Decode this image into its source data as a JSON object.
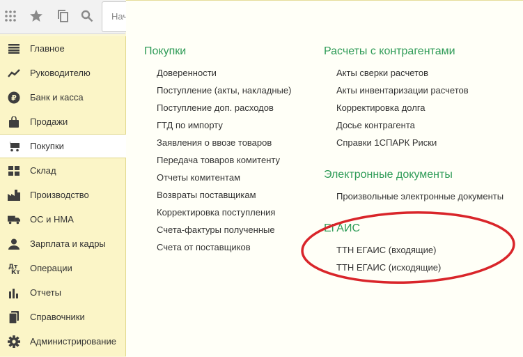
{
  "toolbar": {
    "icons": [
      "apps-grid-icon",
      "star-icon",
      "history-icon",
      "search-icon"
    ],
    "search_text": "Нач"
  },
  "sidebar": {
    "items": [
      {
        "label": "Главное",
        "icon": "menu-lines-icon"
      },
      {
        "label": "Руководителю",
        "icon": "trend-icon"
      },
      {
        "label": "Банк и касса",
        "icon": "ruble-coin-icon"
      },
      {
        "label": "Продажи",
        "icon": "shopping-bag-icon"
      },
      {
        "label": "Покупки",
        "icon": "cart-icon",
        "active": true
      },
      {
        "label": "Склад",
        "icon": "warehouse-grid-icon"
      },
      {
        "label": "Производство",
        "icon": "factory-icon"
      },
      {
        "label": "ОС и НМА",
        "icon": "truck-icon"
      },
      {
        "label": "Зарплата и кадры",
        "icon": "person-icon"
      },
      {
        "label": "Операции",
        "icon": "debit-credit-icon"
      },
      {
        "label": "Отчеты",
        "icon": "bar-chart-icon"
      },
      {
        "label": "Справочники",
        "icon": "books-icon"
      },
      {
        "label": "Администрирование",
        "icon": "gear-icon"
      }
    ]
  },
  "sections": {
    "purchases": {
      "title": "Покупки",
      "links": [
        "Доверенности",
        "Поступление (акты, накладные)",
        "Поступление доп. расходов",
        "ГТД по импорту",
        "Заявления о ввозе товаров",
        "Передача товаров комитенту",
        "Отчеты комитентам",
        "Возвраты поставщикам",
        "Корректировка поступления",
        "Счета-фактуры полученные",
        "Счета от поставщиков"
      ]
    },
    "settlements": {
      "title": "Расчеты с контрагентами",
      "links": [
        "Акты сверки расчетов",
        "Акты инвентаризации расчетов",
        "Корректировка долга",
        "Досье контрагента",
        "Справки 1СПАРК Риски"
      ]
    },
    "edocs": {
      "title": "Электронные документы",
      "links": [
        "Произвольные электронные документы"
      ]
    },
    "egais": {
      "title": "ЕГАИС",
      "links": [
        "ТТН ЕГАИС (входящие)",
        "ТТН ЕГАИС (исходящие)"
      ]
    }
  },
  "colors": {
    "section_title": "#2e9b57",
    "sidebar_bg": "#fbf5c7",
    "highlight_ellipse": "#d9252a"
  }
}
